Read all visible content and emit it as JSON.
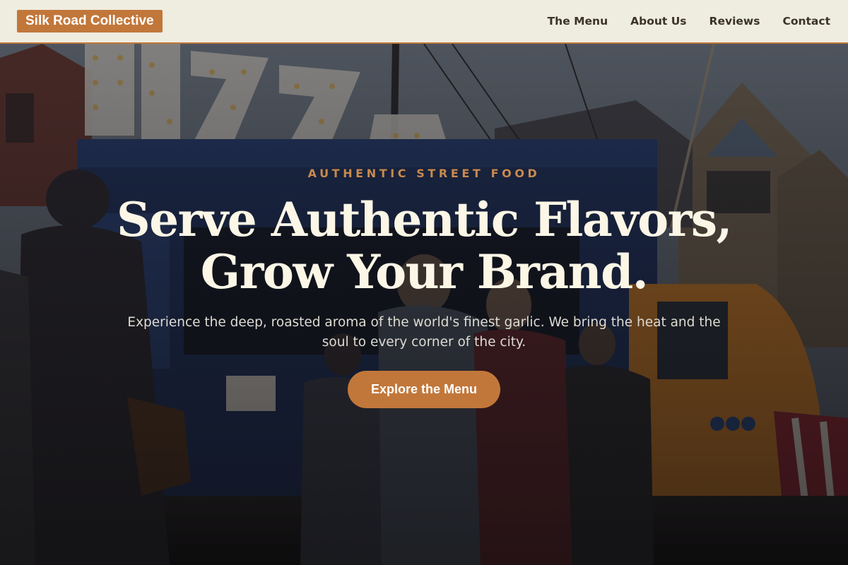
{
  "header": {
    "logo_text": "Silk Road Collective",
    "nav": [
      {
        "label": "The Menu"
      },
      {
        "label": "About Us"
      },
      {
        "label": "Reviews"
      },
      {
        "label": "Contact"
      }
    ]
  },
  "hero": {
    "eyebrow": "AUTHENTIC STREET FOOD",
    "headline_line1": "Serve Authentic Flavors,",
    "headline_line2": "Grow Your Brand.",
    "subtitle": "Experience the deep, roasted aroma of the world's finest garlic. We bring the heat and the soul to every corner of the city.",
    "cta_label": "Explore the Menu",
    "background_sign_text": "PIZZA"
  },
  "colors": {
    "accent": "#c2773a",
    "header_bg": "#efece0",
    "headline": "#fbf6e6",
    "eyebrow": "#c98a4e"
  }
}
